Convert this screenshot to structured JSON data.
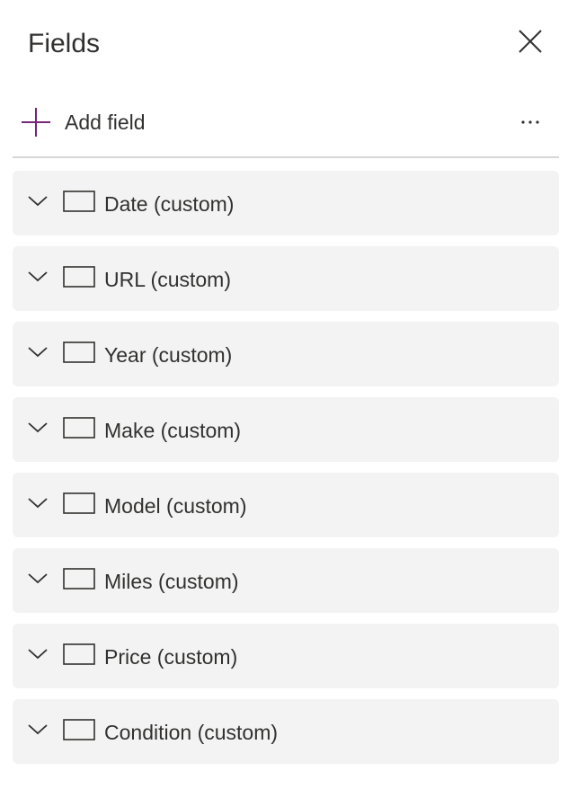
{
  "panel": {
    "title": "Fields",
    "close_icon": "close-icon"
  },
  "toolbar": {
    "add_field_label": "Add field",
    "add_icon": "plus-icon",
    "more_icon": "more-options-icon",
    "accent_color": "#742774"
  },
  "fields": [
    {
      "label": "Date (custom)"
    },
    {
      "label": "URL (custom)"
    },
    {
      "label": "Year (custom)"
    },
    {
      "label": "Make (custom)"
    },
    {
      "label": "Model (custom)"
    },
    {
      "label": "Miles (custom)"
    },
    {
      "label": "Price (custom)"
    },
    {
      "label": "Condition (custom)"
    }
  ],
  "colors": {
    "row_background": "#f3f3f3",
    "divider": "#d6d6d6",
    "text": "#323130"
  }
}
